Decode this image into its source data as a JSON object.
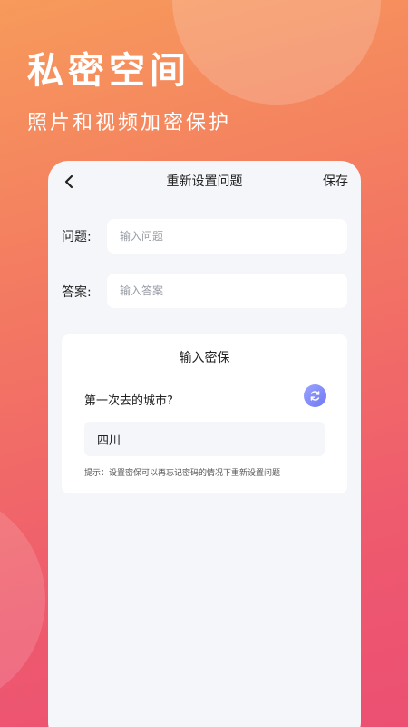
{
  "hero": {
    "title": "私密空间",
    "subtitle": "照片和视频加密保护"
  },
  "nav": {
    "back_icon": "chevron-left-icon",
    "title": "重新设置问题",
    "save_label": "保存"
  },
  "form": {
    "question_label": "问题:",
    "question_placeholder": "输入问题",
    "question_value": "",
    "answer_label": "答案:",
    "answer_placeholder": "输入答案",
    "answer_value": ""
  },
  "security_card": {
    "title": "输入密保",
    "question": "第一次去的城市?",
    "refresh_icon": "refresh-icon",
    "answer_value": "四川",
    "hint": "提示：设置密保可以再忘记密码的情况下重新设置问题"
  },
  "colors": {
    "gradient_start": "#f79a5b",
    "gradient_end": "#ec4f72",
    "panel_bg": "#f5f6fa",
    "refresh_accent": "#7e87f7"
  }
}
